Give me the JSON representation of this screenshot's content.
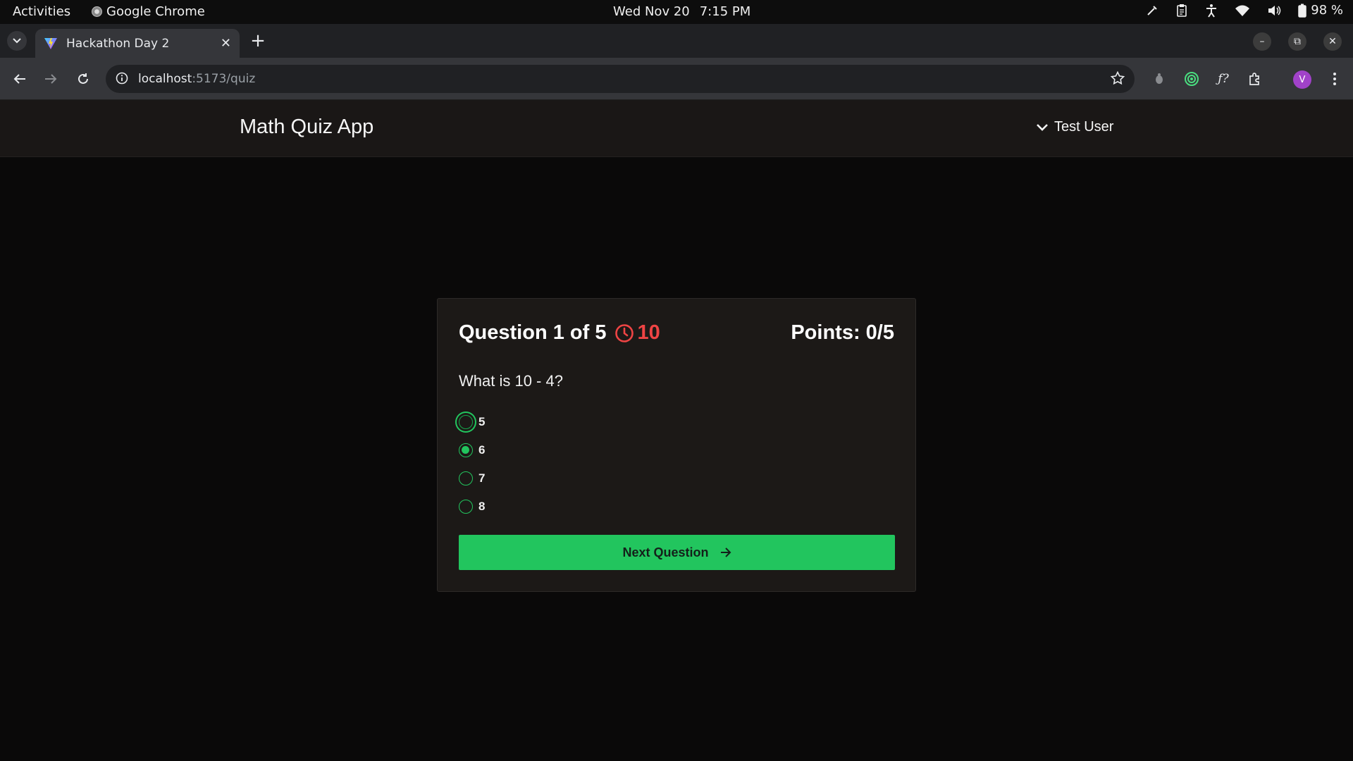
{
  "system_bar": {
    "activities": "Activities",
    "app_name": "Google Chrome",
    "date": "Wed Nov 20",
    "time": "7:15 PM",
    "battery": "98 %"
  },
  "browser": {
    "tab_title": "Hackathon Day 2",
    "url_host": "localhost",
    "url_path": ":5173/quiz",
    "profile_initial": "V"
  },
  "header": {
    "title": "Math Quiz App",
    "user_name": "Test User"
  },
  "quiz": {
    "question_label": "Question 1 of 5",
    "timer": "10",
    "points": "Points: 0/5",
    "question": "What is 10 - 4?",
    "options": [
      {
        "label": "5",
        "checked": false
      },
      {
        "label": "6",
        "checked": true
      },
      {
        "label": "7",
        "checked": false
      },
      {
        "label": "8",
        "checked": false
      }
    ],
    "next_label": "Next Question"
  },
  "colors": {
    "accent": "#22c55e",
    "timer": "#ef4444",
    "card_bg": "#1c1917",
    "page_bg": "#0a0909"
  }
}
